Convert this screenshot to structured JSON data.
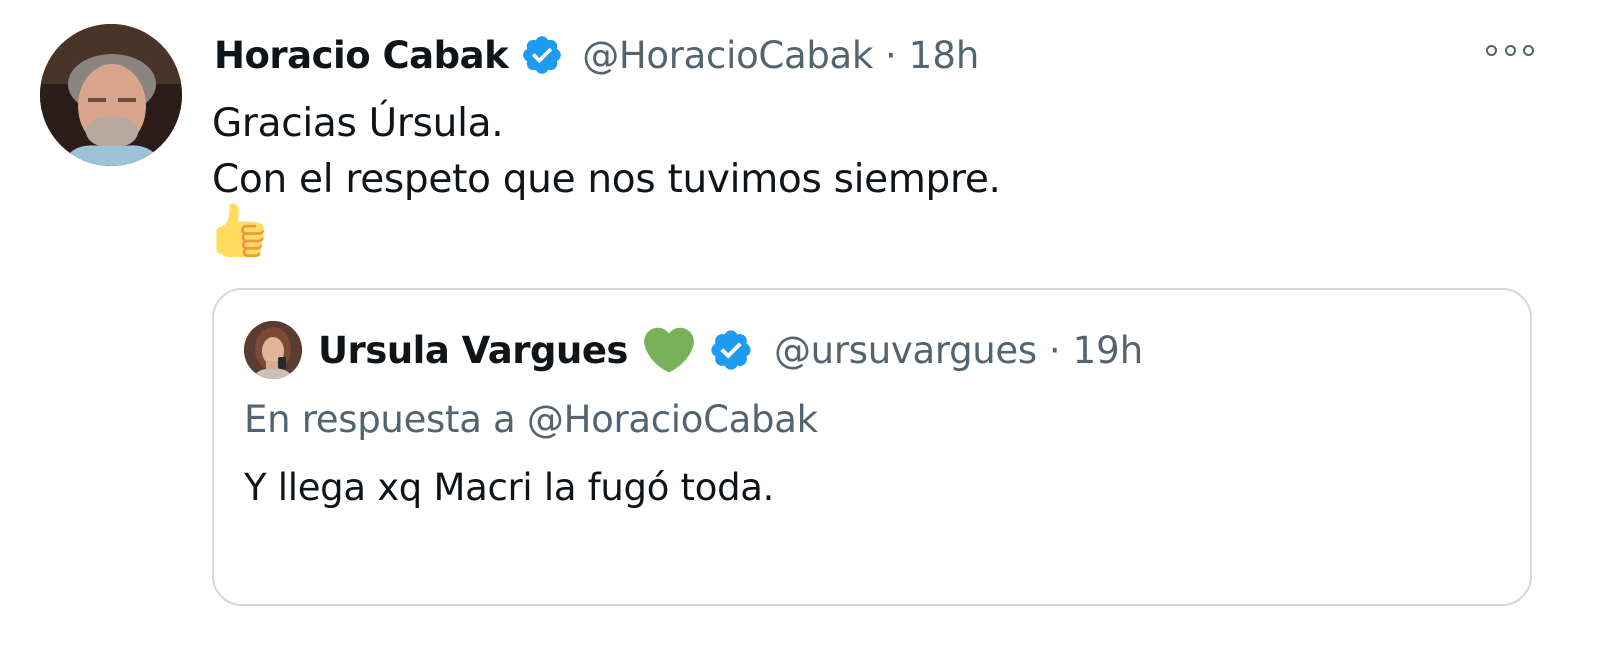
{
  "tweet": {
    "author": {
      "name": "Horacio Cabak",
      "handle": "@HoracioCabak",
      "time": "18h",
      "verified": true,
      "avatar_icon": "avatar-horacio"
    },
    "separator": "·",
    "text_lines": [
      "Gracias Úrsula.",
      "Con el respeto que nos tuvimos siempre."
    ],
    "emoji": "thumbs-up-icon",
    "more_icon": "more-options-icon",
    "quoted": {
      "author": {
        "name": "Ursula Vargues",
        "handle": "@ursuvargues",
        "time": "19h",
        "verified": true,
        "emoji": "green-heart-icon",
        "avatar_icon": "avatar-ursula"
      },
      "reply_prefix": "En respuesta a",
      "reply_to": "@HoracioCabak",
      "text": "Y llega xq Macri la fugó toda."
    }
  },
  "colors": {
    "text": "#0f1419",
    "secondary": "#536471",
    "verified_blue": "#1d9bf0",
    "border": "#cfd9de",
    "heart_green": "#78b159"
  }
}
